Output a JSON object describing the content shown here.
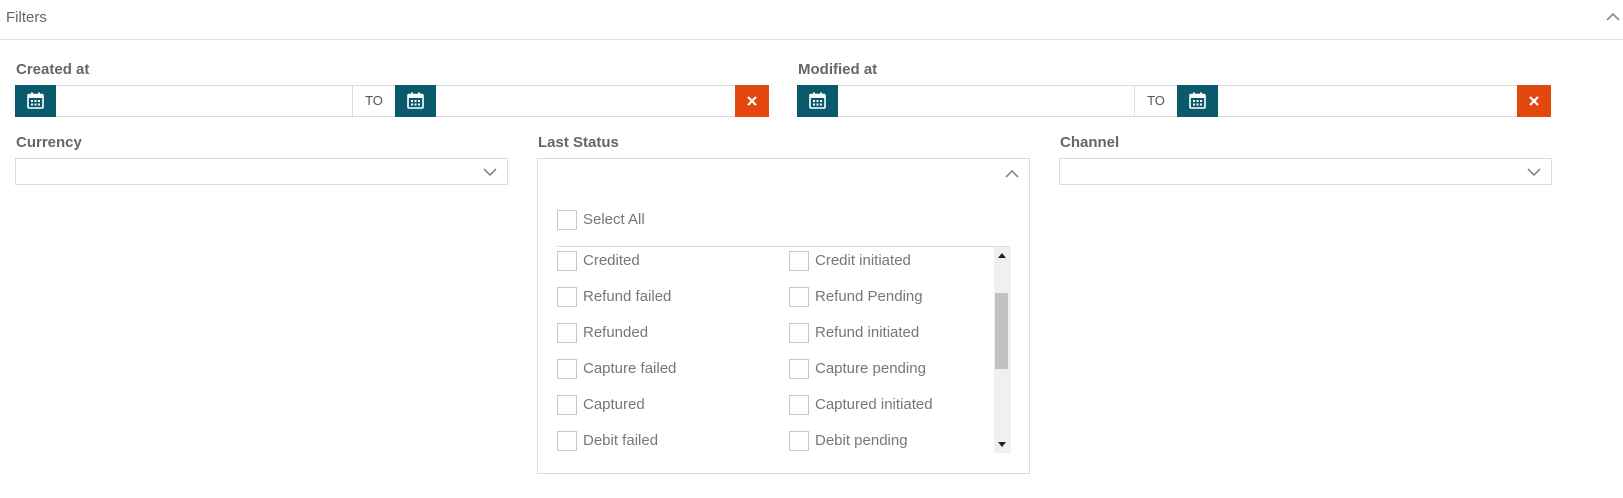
{
  "header": {
    "title": "Filters",
    "collapse_icon": "chevron-up-icon"
  },
  "created_at": {
    "label": "Created at",
    "to_label": "TO",
    "from_value": "",
    "to_value": ""
  },
  "modified_at": {
    "label": "Modified at",
    "to_label": "TO",
    "from_value": "",
    "to_value": ""
  },
  "currency": {
    "label": "Currency",
    "value": ""
  },
  "last_status": {
    "label": "Last Status",
    "value": "",
    "select_all": "Select All",
    "options_left": [
      "Credited",
      "Refund failed",
      "Refunded",
      "Capture failed",
      "Captured",
      "Debit failed"
    ],
    "options_right": [
      "Credit initiated",
      "Refund Pending",
      "Refund initiated",
      "Capture pending",
      "Captured initiated",
      "Debit pending"
    ]
  },
  "channel": {
    "label": "Channel",
    "value": ""
  },
  "colors": {
    "calendar_button": "#0a5a6e",
    "clear_button": "#e2470e",
    "border": "#dcdcdc",
    "text": "#666666"
  }
}
